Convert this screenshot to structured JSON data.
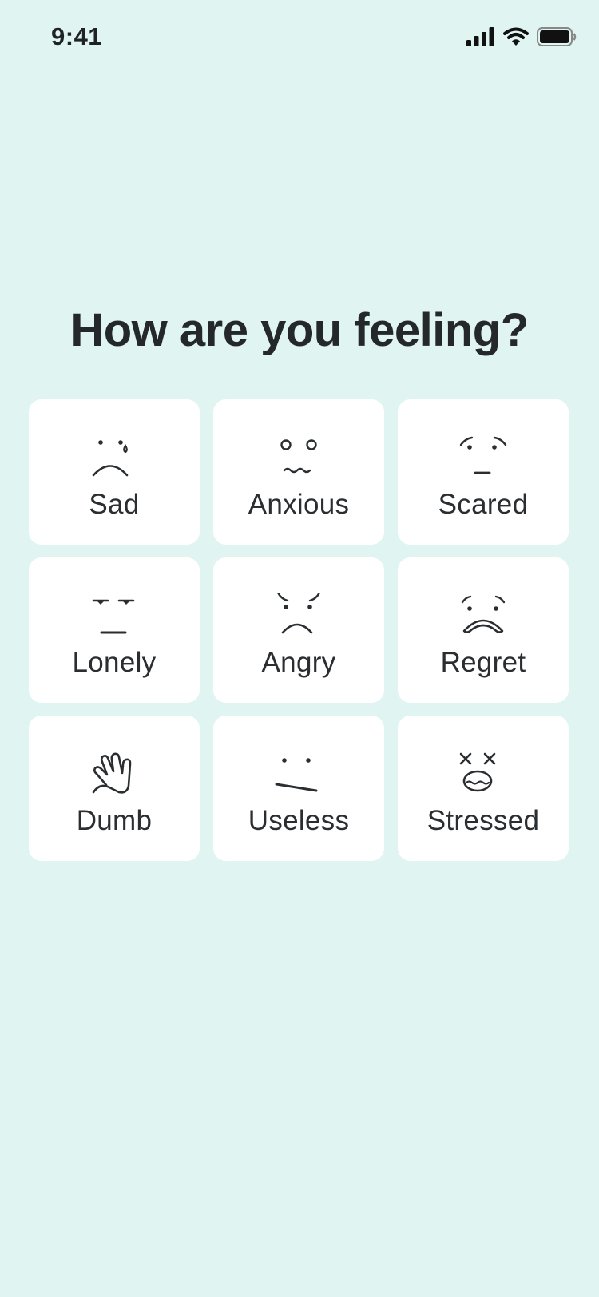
{
  "status_bar": {
    "time": "9:41",
    "icons": [
      "cellular-signal-icon",
      "wifi-icon",
      "battery-icon"
    ]
  },
  "title": "How are you feeling?",
  "colors": {
    "background": "#E0F5F2",
    "card": "#FFFFFF",
    "text": "#262A2D"
  },
  "moods": [
    {
      "label": "Sad",
      "icon": "sad-face-icon"
    },
    {
      "label": "Anxious",
      "icon": "anxious-face-icon"
    },
    {
      "label": "Scared",
      "icon": "scared-face-icon"
    },
    {
      "label": "Lonely",
      "icon": "lonely-face-icon"
    },
    {
      "label": "Angry",
      "icon": "angry-face-icon"
    },
    {
      "label": "Regret",
      "icon": "regret-face-icon"
    },
    {
      "label": "Dumb",
      "icon": "facepalm-icon"
    },
    {
      "label": "Useless",
      "icon": "useless-face-icon"
    },
    {
      "label": "Stressed",
      "icon": "stressed-face-icon"
    }
  ]
}
